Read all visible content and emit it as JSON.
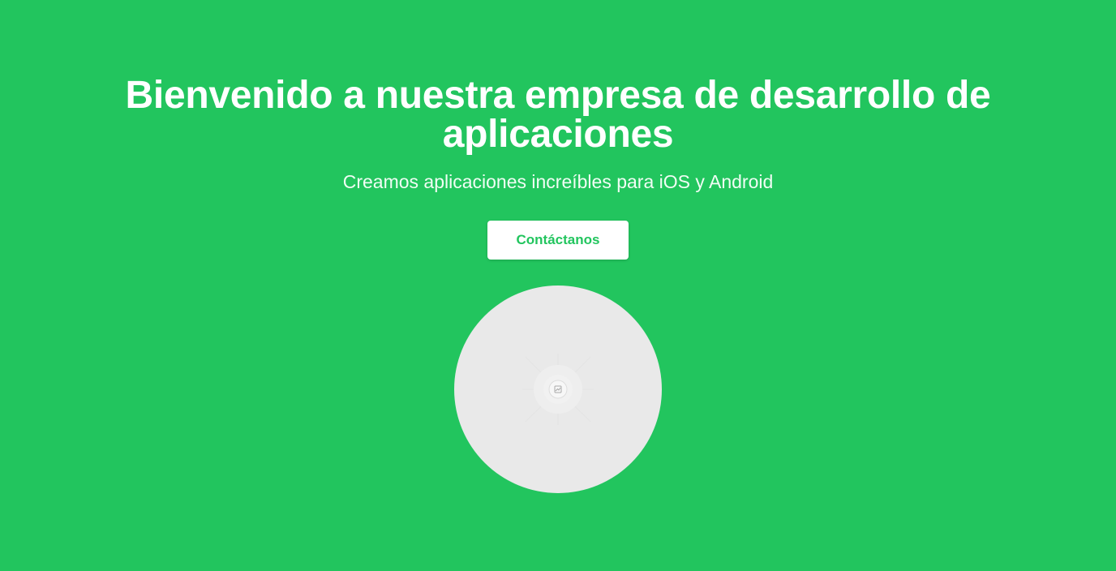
{
  "hero": {
    "title_line1": "Bienvenido a nuestra empresa de desarrollo de",
    "title_line2": "aplicaciones",
    "subtitle": "Creamos aplicaciones increíbles para iOS y Android",
    "cta_label": "Contáctanos"
  },
  "colors": {
    "background": "#22c55e",
    "button_bg": "#ffffff",
    "button_text": "#22c55e",
    "image_placeholder": "#e9e9e9"
  },
  "icons": {
    "image_placeholder": "image-placeholder-icon"
  }
}
